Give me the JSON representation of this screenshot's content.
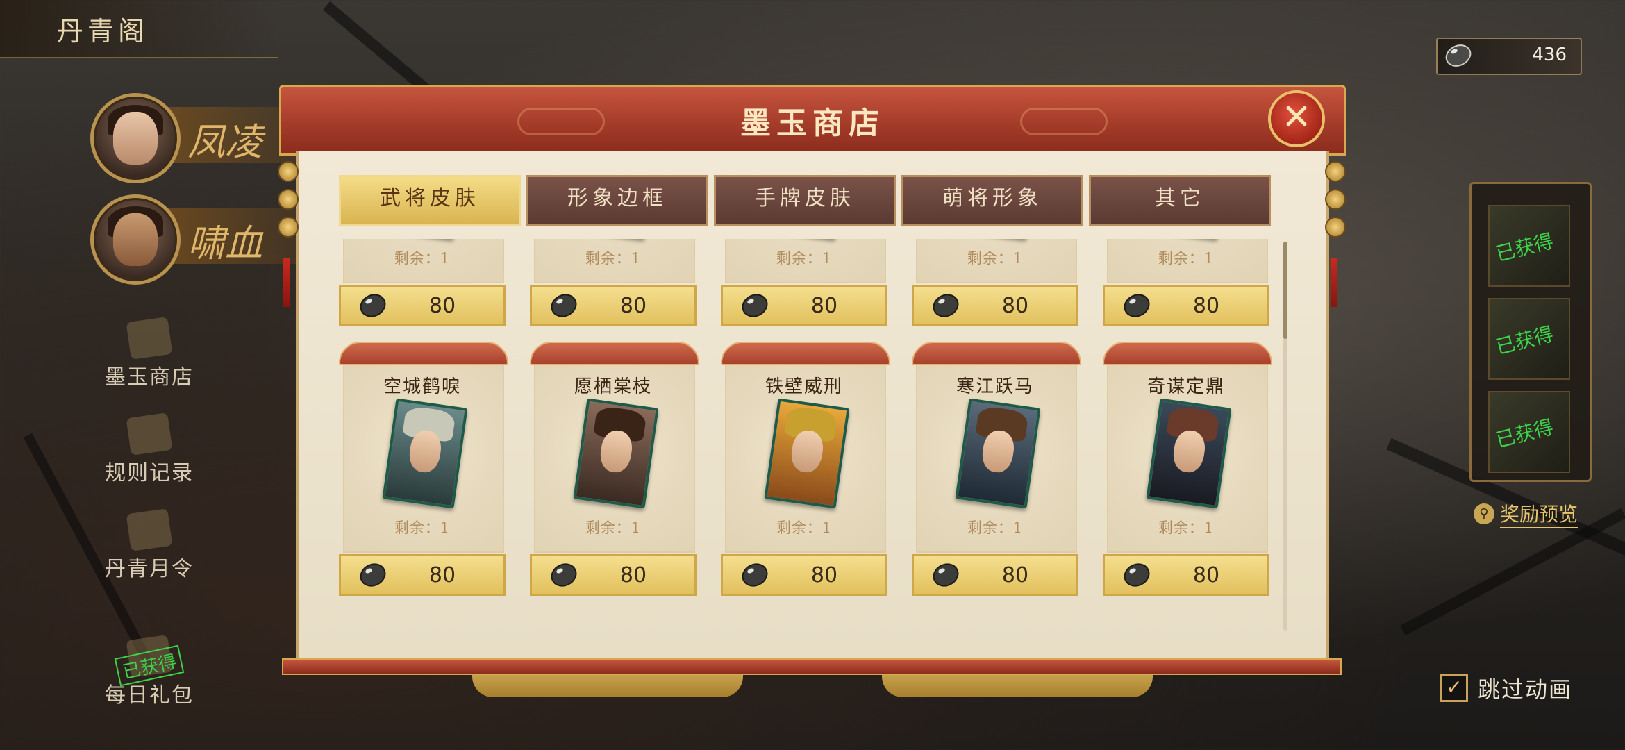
{
  "app": {
    "title": "丹青阁"
  },
  "currency": {
    "icon": "jade-stone-icon",
    "amount": "436"
  },
  "heroes": [
    {
      "name": "凤凌"
    },
    {
      "name": "啸血"
    }
  ],
  "sidebar": {
    "items": [
      {
        "label": "墨玉商店",
        "icon": "shop-icon"
      },
      {
        "label": "规则记录",
        "icon": "scroll-icon"
      },
      {
        "label": "丹青月令",
        "icon": "token-icon"
      },
      {
        "label": "每日礼包",
        "icon": "gift-icon",
        "badge": "已获得"
      }
    ]
  },
  "right_panel": {
    "obtained": [
      "已获得",
      "已获得",
      "已获得"
    ],
    "preview_label": "奖励预览",
    "skip_label": "跳过动画",
    "skip_checked": true
  },
  "dialog": {
    "title": "墨玉商店",
    "close_icon": "close-icon",
    "tabs": [
      {
        "label": "武将皮肤",
        "active": true
      },
      {
        "label": "形象边框",
        "active": false
      },
      {
        "label": "手牌皮肤",
        "active": false
      },
      {
        "label": "萌将形象",
        "active": false
      },
      {
        "label": "其它",
        "active": false
      }
    ],
    "top_row": [
      {
        "stock": "剩余：1",
        "price": "80"
      },
      {
        "stock": "剩余：1",
        "price": "80"
      },
      {
        "stock": "剩余：1",
        "price": "80"
      },
      {
        "stock": "剩余：1",
        "price": "80"
      },
      {
        "stock": "剩余：1",
        "price": "80"
      }
    ],
    "items": [
      {
        "name": "空城鹤唳",
        "stock": "剩余：1",
        "price": "80"
      },
      {
        "name": "愿栖棠枝",
        "stock": "剩余：1",
        "price": "80"
      },
      {
        "name": "铁壁威刑",
        "stock": "剩余：1",
        "price": "80"
      },
      {
        "name": "寒江跃马",
        "stock": "剩余：1",
        "price": "80"
      },
      {
        "name": "奇谋定鼎",
        "stock": "剩余：1",
        "price": "80"
      }
    ]
  },
  "colors": {
    "header_red": "#a23a28",
    "gold": "#d8b450",
    "parchment": "#f1e9d6",
    "obtained_green": "#3dd24a"
  }
}
